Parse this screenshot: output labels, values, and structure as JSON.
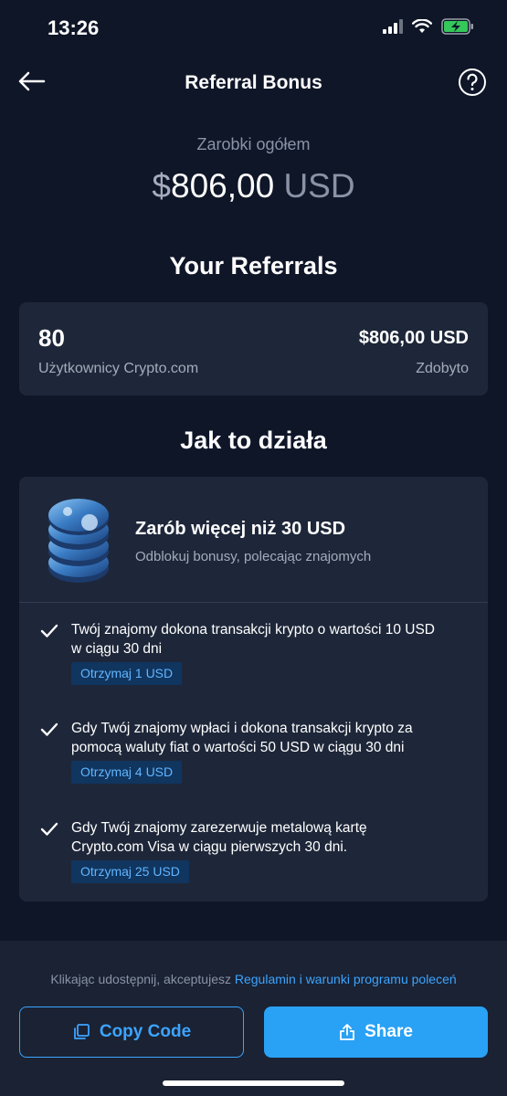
{
  "status_bar": {
    "time": "13:26"
  },
  "header": {
    "title": "Referral Bonus"
  },
  "earnings": {
    "label": "Zarobki ogółem",
    "symbol": "$",
    "amount": "806,00",
    "currency": "USD"
  },
  "referrals": {
    "title": "Your Referrals",
    "count": "80",
    "count_label": "Użytkownicy Crypto.com",
    "earned": "$806,00 USD",
    "earned_label": "Zdobyto"
  },
  "how_it_works": {
    "title": "Jak to działa",
    "card_title": "Zarób więcej niż 30 USD",
    "card_subtitle": "Odblokuj bonusy, polecając znajomych",
    "steps": [
      {
        "line1": "Twój znajomy dokona transakcji krypto o wartości 10 USD",
        "line2": "w ciągu 30 dni",
        "badge": "Otrzymaj 1 USD"
      },
      {
        "line1": "Gdy Twój znajomy wpłaci i dokona transakcji krypto za",
        "line2": "pomocą waluty fiat o wartości 50 USD w ciągu 30 dni",
        "badge": "Otrzymaj 4 USD"
      },
      {
        "line1": "Gdy Twój znajomy zarezerwuje metalową kartę",
        "line2": "Crypto.com Visa w ciągu pierwszych 30 dni.",
        "badge": "Otrzymaj 25 USD"
      }
    ]
  },
  "footer": {
    "terms_prefix": "Klikając udostępnij, akceptujesz ",
    "terms_link": "Regulamin i warunki programu poleceń",
    "copy_label": "Copy Code",
    "share_label": "Share"
  },
  "colors": {
    "background": "#0f1628",
    "card": "#1e2739",
    "accent": "#29a1f5",
    "badge_bg": "#10355f",
    "badge_text": "#61b5ff"
  },
  "icons": [
    "back-arrow-icon",
    "help-icon",
    "check-icon",
    "copy-icon",
    "share-icon",
    "coin-stack-icon",
    "signal-icon",
    "wifi-icon",
    "battery-icon"
  ]
}
